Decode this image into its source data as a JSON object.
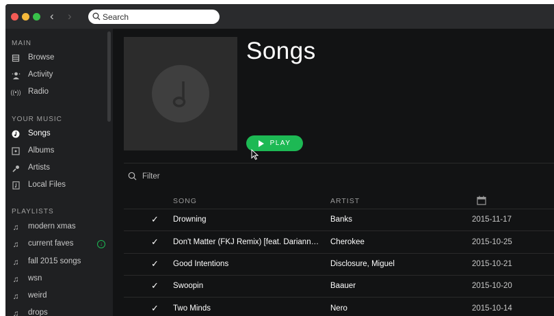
{
  "titlebar": {
    "search_placeholder": "Search"
  },
  "sidebar": {
    "main_header": "MAIN",
    "main_items": [
      {
        "label": "Browse",
        "icon": "browse-icon"
      },
      {
        "label": "Activity",
        "icon": "activity-icon"
      },
      {
        "label": "Radio",
        "icon": "radio-icon"
      }
    ],
    "your_music_header": "YOUR MUSIC",
    "your_music_items": [
      {
        "label": "Songs",
        "icon": "song-note-icon",
        "active": true
      },
      {
        "label": "Albums",
        "icon": "album-icon"
      },
      {
        "label": "Artists",
        "icon": "artist-icon"
      },
      {
        "label": "Local Files",
        "icon": "local-files-icon"
      }
    ],
    "playlists_header": "PLAYLISTS",
    "playlists": [
      {
        "label": "modern xmas",
        "icon": "playlist-note-icon"
      },
      {
        "label": "current faves",
        "icon": "playlist-note-icon",
        "downloaded": true
      },
      {
        "label": "fall 2015 songs",
        "icon": "playlist-note-icon"
      },
      {
        "label": "wsn",
        "icon": "playlist-note-icon"
      },
      {
        "label": "weird",
        "icon": "playlist-note-icon"
      },
      {
        "label": "drops",
        "icon": "playlist-note-icon"
      }
    ]
  },
  "main": {
    "title": "Songs",
    "play_label": "PLAY",
    "filter_placeholder": "Filter",
    "columns": {
      "song": "SONG",
      "artist": "ARTIST",
      "date_icon": "calendar-icon"
    },
    "rows": [
      {
        "song": "Drowning",
        "artist": "Banks",
        "date": "2015-11-17"
      },
      {
        "song": "Don't Matter (FKJ Remix) [feat. Darianna Ev...",
        "artist": "Cherokee",
        "date": "2015-10-25"
      },
      {
        "song": "Good Intentions",
        "artist": "Disclosure, Miguel",
        "date": "2015-10-21"
      },
      {
        "song": "Swoopin",
        "artist": "Baauer",
        "date": "2015-10-20"
      },
      {
        "song": "Two Minds",
        "artist": "Nero",
        "date": "2015-10-14"
      }
    ]
  },
  "colors": {
    "accent": "#1db954",
    "sidebar_bg": "#1f2022",
    "main_bg": "#121314",
    "titlebar_bg": "#2a2b2d"
  }
}
